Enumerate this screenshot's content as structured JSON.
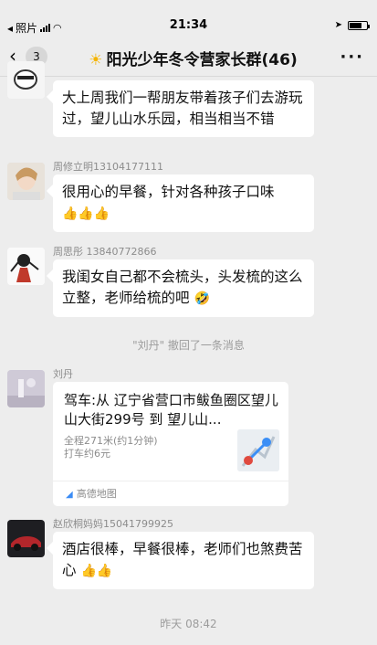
{
  "status_bar": {
    "app_name": "照片",
    "time": "21:34"
  },
  "nav": {
    "back_count": "3",
    "title": "阳光少年冬令营家长群(46)"
  },
  "messages": [
    {
      "sender": "",
      "text": "大上周我们一帮朋友带着孩子们去游玩过，望儿山水乐园，相当相当不错"
    },
    {
      "sender": "周修立明13104177111",
      "text": "很用心的早餐，针对各种孩子口味",
      "emoji": "👍👍👍"
    },
    {
      "sender": "周思彤 13840772866",
      "text": "我闺女自己都不会梳头，头发梳的这么立整，老师给梳的吧",
      "emoji": "🤣"
    }
  ],
  "system_note": "\"刘丹\" 撤回了一条消息",
  "location_message": {
    "sender": "刘丹",
    "title": "驾车:从 辽宁省营口市鲅鱼圈区望儿山大街299号 到 望儿山...",
    "distance": "全程271米(约1分钟)",
    "fare": "打车约6元",
    "source": "高德地图"
  },
  "last_message": {
    "sender": "赵欣桐妈妈15041799925",
    "text": "酒店很棒，早餐很棒，老师们也煞费苦心",
    "emoji": "👍👍"
  },
  "time_divider": "昨天 08:42",
  "colors": {
    "background": "#ededed",
    "bubble": "#ffffff",
    "meta_text": "#8c8c8c"
  }
}
